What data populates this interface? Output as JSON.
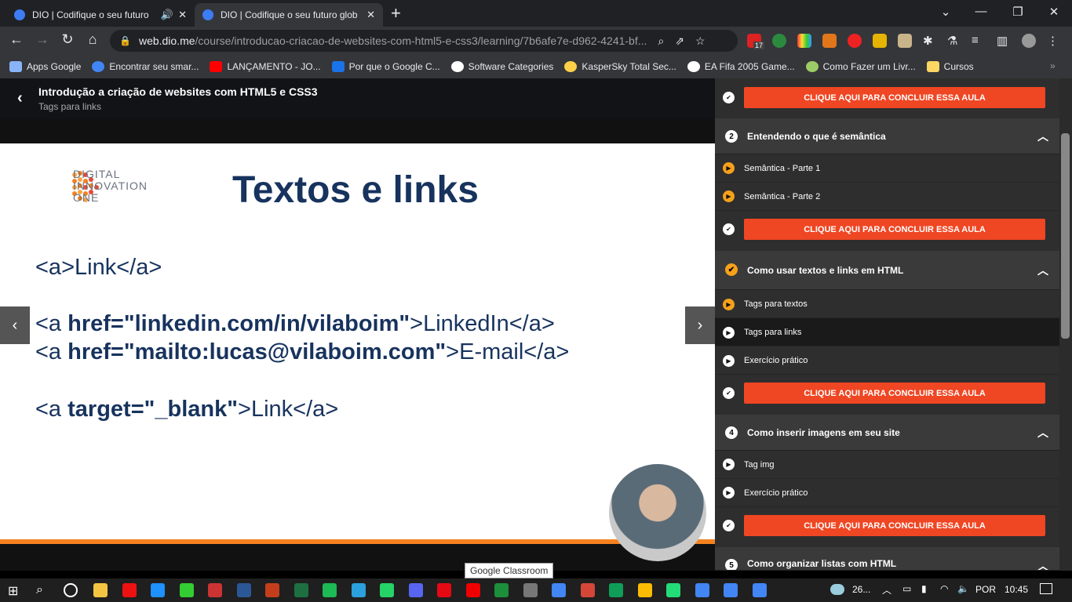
{
  "browser": {
    "tabs": [
      {
        "title": "DIO | Codifique o seu futuro"
      },
      {
        "title": "DIO | Codifique o seu futuro glob"
      }
    ],
    "url_host": "web.dio.me",
    "url_path": "/course/introducao-criacao-de-websites-com-html5-e-css3/learning/7b6afe7e-d962-4241-bf...",
    "extension_badge": "17",
    "bookmarks": [
      "Apps Google",
      "Encontrar seu smar...",
      "LANÇAMENTO - JO...",
      "Por que o Google C...",
      "Software Categories",
      "KasperSky Total Sec...",
      "EA Fifa 2005 Game...",
      "Como Fazer um Livr...",
      "Cursos"
    ],
    "bookmark_colors": [
      "#8ab4f8",
      "#4285f4",
      "#ff0000",
      "#1a73e8",
      "#ffffff",
      "#ffcf48",
      "#ffffff",
      "#9ccc65",
      "#fdd663"
    ]
  },
  "course": {
    "title": "Introdução a criação de websites com HTML5 e CSS3",
    "lesson": "Tags para links"
  },
  "slide": {
    "logo_line1": "DIGITAL",
    "logo_line2": "INNOVATION",
    "logo_line3": "ONE",
    "title": "Textos e links",
    "line1": "<a>Link</a>",
    "line2_pre": "<a ",
    "line2_bold": "href=\"linkedin.com/in/vilaboim\"",
    "line2_post": ">LinkedIn</a>",
    "line3_pre": "<a ",
    "line3_bold": "href=\"mailto:lucas@vilaboim.com\"",
    "line3_post": ">E-mail</a>",
    "line4_pre": "<a ",
    "line4_bold": "target=\"_blank\"",
    "line4_post": ">Link</a>"
  },
  "tooltip": "Google Classroom",
  "sidebar": {
    "conclude_label": "CLIQUE AQUI PARA CONCLUIR ESSA AULA",
    "s2": {
      "num": "2",
      "title": "Entendendo o que é semântica",
      "lessons": [
        "Semântica - Parte 1",
        "Semântica - Parte 2"
      ]
    },
    "s3": {
      "title": "Como usar textos e links em HTML",
      "lessons": [
        "Tags para textos",
        "Tags para links",
        "Exercício prático"
      ]
    },
    "s4": {
      "num": "4",
      "title": "Como inserir imagens em seu site",
      "lessons": [
        "Tag img",
        "Exercício prático"
      ]
    },
    "s5": {
      "num": "5",
      "title": "Como organizar listas com HTML"
    }
  },
  "taskbar": {
    "weather": "26...",
    "lang": "POR",
    "time": "10:45",
    "app_colors": [
      "#f4c542",
      "#e11",
      "#1e90ff",
      "#3c3",
      "#c33",
      "#2b5797",
      "#c43e1c",
      "#1d6f42",
      "#1db954",
      "#2aa1de",
      "#25d366",
      "#5865f2",
      "#e50914",
      "#e00",
      "#1b8f3a",
      "#777",
      "#4285f4",
      "#d44638",
      "#0f9d58",
      "#fbbc04",
      "#2d7",
      "#4285f4",
      "#4285f4",
      "#4285f4"
    ]
  }
}
